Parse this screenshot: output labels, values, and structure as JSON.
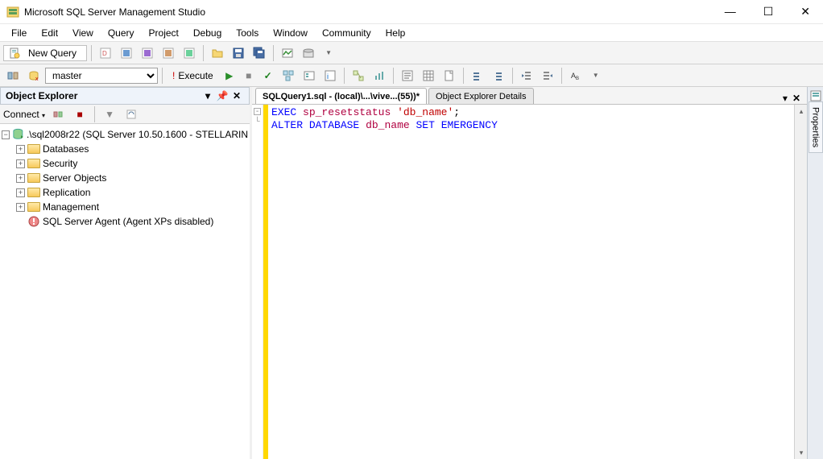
{
  "window": {
    "title": "Microsoft SQL Server Management Studio"
  },
  "menu": {
    "items": [
      "File",
      "Edit",
      "View",
      "Query",
      "Project",
      "Debug",
      "Tools",
      "Window",
      "Community",
      "Help"
    ]
  },
  "toolbar1": {
    "new_query": "New Query"
  },
  "toolbar2": {
    "database": "master",
    "execute": "Execute"
  },
  "object_explorer": {
    "title": "Object Explorer",
    "connect_label": "Connect",
    "root": ".\\sql2008r22 (SQL Server 10.50.1600 - STELLARIN",
    "nodes": [
      "Databases",
      "Security",
      "Server Objects",
      "Replication",
      "Management",
      "SQL Server Agent (Agent XPs disabled)"
    ]
  },
  "tabs": {
    "active": "SQLQuery1.sql - (local)\\...\\vive...(55))*",
    "inactive": "Object Explorer Details"
  },
  "code": {
    "line1": {
      "kw1": "EXEC",
      "proc": "sp_resetstatus",
      "str": "'db_name'",
      "semi": ";"
    },
    "line2": {
      "kw1": "ALTER",
      "kw2": "DATABASE",
      "ident": "db_name",
      "kw3": "SET",
      "kw4": "EMERGENCY"
    }
  },
  "side_panel": {
    "label": "Properties"
  }
}
